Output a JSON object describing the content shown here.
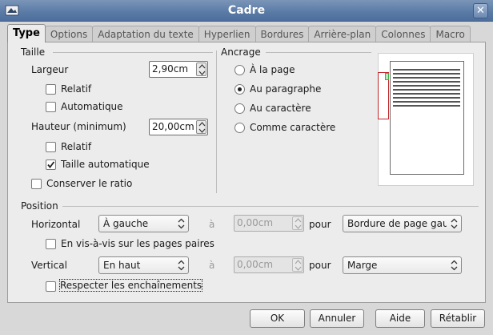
{
  "window": {
    "title": "Cadre"
  },
  "tabs": [
    {
      "label": "Type",
      "active": true
    },
    {
      "label": "Options"
    },
    {
      "label": "Adaptation du texte"
    },
    {
      "label": "Hyperlien"
    },
    {
      "label": "Bordures"
    },
    {
      "label": "Arrière-plan"
    },
    {
      "label": "Colonnes"
    },
    {
      "label": "Macro"
    }
  ],
  "size": {
    "title": "Taille",
    "width": {
      "label": "Largeur",
      "value": "2,90cm",
      "relative_label": "Relatif",
      "relative_checked": false,
      "auto_label": "Automatique",
      "auto_checked": false
    },
    "height": {
      "label": "Hauteur (minimum)",
      "value": "20,00cm",
      "relative_label": "Relatif",
      "relative_checked": false,
      "auto_label": "Taille automatique",
      "auto_checked": true
    },
    "keep_ratio_label": "Conserver le ratio",
    "keep_ratio_checked": false
  },
  "anchor": {
    "title": "Ancrage",
    "options": [
      {
        "label": "À la page",
        "selected": false
      },
      {
        "label": "Au paragraphe",
        "selected": true
      },
      {
        "label": "Au caractère",
        "selected": false
      },
      {
        "label": "Comme caractère",
        "selected": false
      }
    ]
  },
  "position": {
    "title": "Position",
    "horizontal": {
      "label": "Horizontal",
      "value": "À gauche",
      "at_label": "à",
      "offset": "0,00cm",
      "to_label": "pour",
      "to_value": "Bordure de page gauche"
    },
    "mirror_label": "En vis-à-vis sur les pages paires",
    "mirror_checked": false,
    "vertical": {
      "label": "Vertical",
      "value": "En haut",
      "at_label": "à",
      "offset": "0,00cm",
      "to_label": "pour",
      "to_value": "Marge"
    },
    "follow_flow_label": "Respecter les enchaînements",
    "follow_flow_checked": false
  },
  "buttons": {
    "ok": "OK",
    "cancel": "Annuler",
    "help": "Aide",
    "reset": "Rétablir"
  },
  "colors": {
    "titlebar": "#5a7aa6",
    "frame_outline": "#c0262c",
    "frame_handle": "#3cb043"
  }
}
